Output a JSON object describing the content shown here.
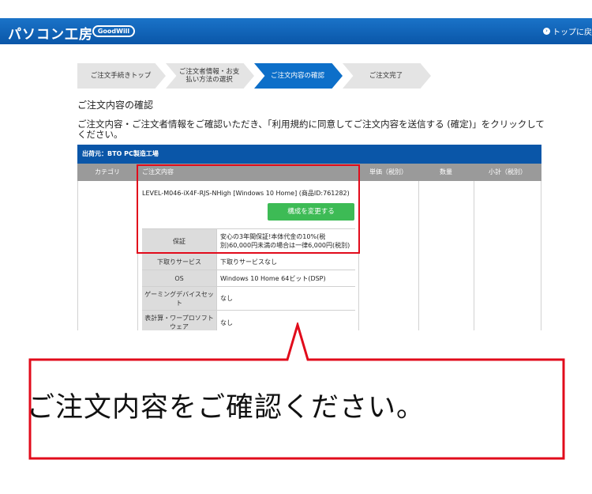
{
  "header": {
    "logo_text": "パソコン工房",
    "logo_badge": "GoodWill",
    "top_link": "トップに戻"
  },
  "steps": [
    {
      "label": "ご注文手続きトップ",
      "active": false
    },
    {
      "label": "ご注文者情報・お支払い方法の選択",
      "active": false
    },
    {
      "label": "ご注文内容の確認",
      "active": true
    },
    {
      "label": "ご注文完了",
      "active": false
    }
  ],
  "section_title": "ご注文内容の確認",
  "intro": "ご注文内容・ご注文者情報をご確認いただき、「利用規約に同意してご注文内容を送信する (確定)」をクリックしてください。",
  "table": {
    "ship_from": "出荷元：BTO PC製造工場",
    "headers": {
      "category": "カテゴリ",
      "content": "ご注文内容",
      "unit_price": "単価（税別）",
      "quantity": "数量",
      "subtotal": "小計（税別）"
    },
    "product_name": "LEVEL-M046-iX4F-RJS-NHigh [Windows 10 Home] (商品ID:761282)",
    "change_button": "構成を変更する",
    "options": [
      {
        "label": "保証",
        "value": "安心の3年間保証!本体代金の10%(税別)60,000円未満の場合は一律6,000円(税別)"
      },
      {
        "label": "下取りサービス",
        "value": "下取りサービスなし"
      },
      {
        "label": "OS",
        "value": "Windows 10 Home 64ビット(DSP)"
      },
      {
        "label": "ゲーミングデバイスセット",
        "value": "なし"
      },
      {
        "label": "表計算・ワープロソフトウェア",
        "value": "なし"
      }
    ]
  },
  "caption": "ご注文内容をご確認ください。",
  "colors": {
    "header_blue": "#0a56a8",
    "active_step": "#0d6fc9",
    "button_green": "#3dbb55",
    "highlight_red": "#e10b1b"
  }
}
